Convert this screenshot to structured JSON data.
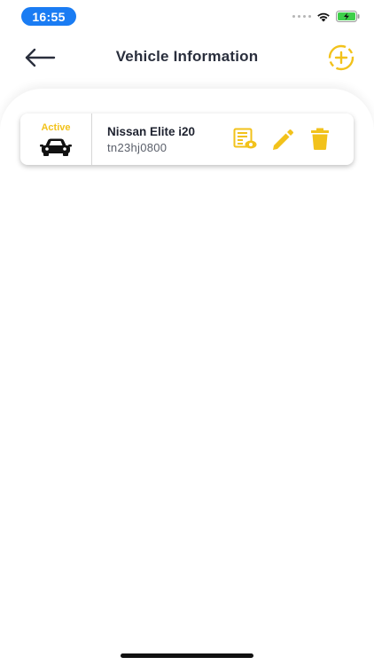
{
  "status_bar": {
    "time": "16:55"
  },
  "header": {
    "title": "Vehicle Information",
    "back_icon": "arrow-left-icon",
    "add_icon": "add-circle-icon"
  },
  "colors": {
    "accent": "#f2c21b",
    "time_pill": "#1a7cf3",
    "battery": "#3fcf4a",
    "title_text": "#2a2f3d"
  },
  "vehicles": [
    {
      "status": "Active",
      "name": "Nissan Elite i20",
      "plate": "tn23hj0800",
      "icon": "car-icon",
      "actions": [
        "documents-icon",
        "edit-icon",
        "delete-icon"
      ]
    }
  ]
}
